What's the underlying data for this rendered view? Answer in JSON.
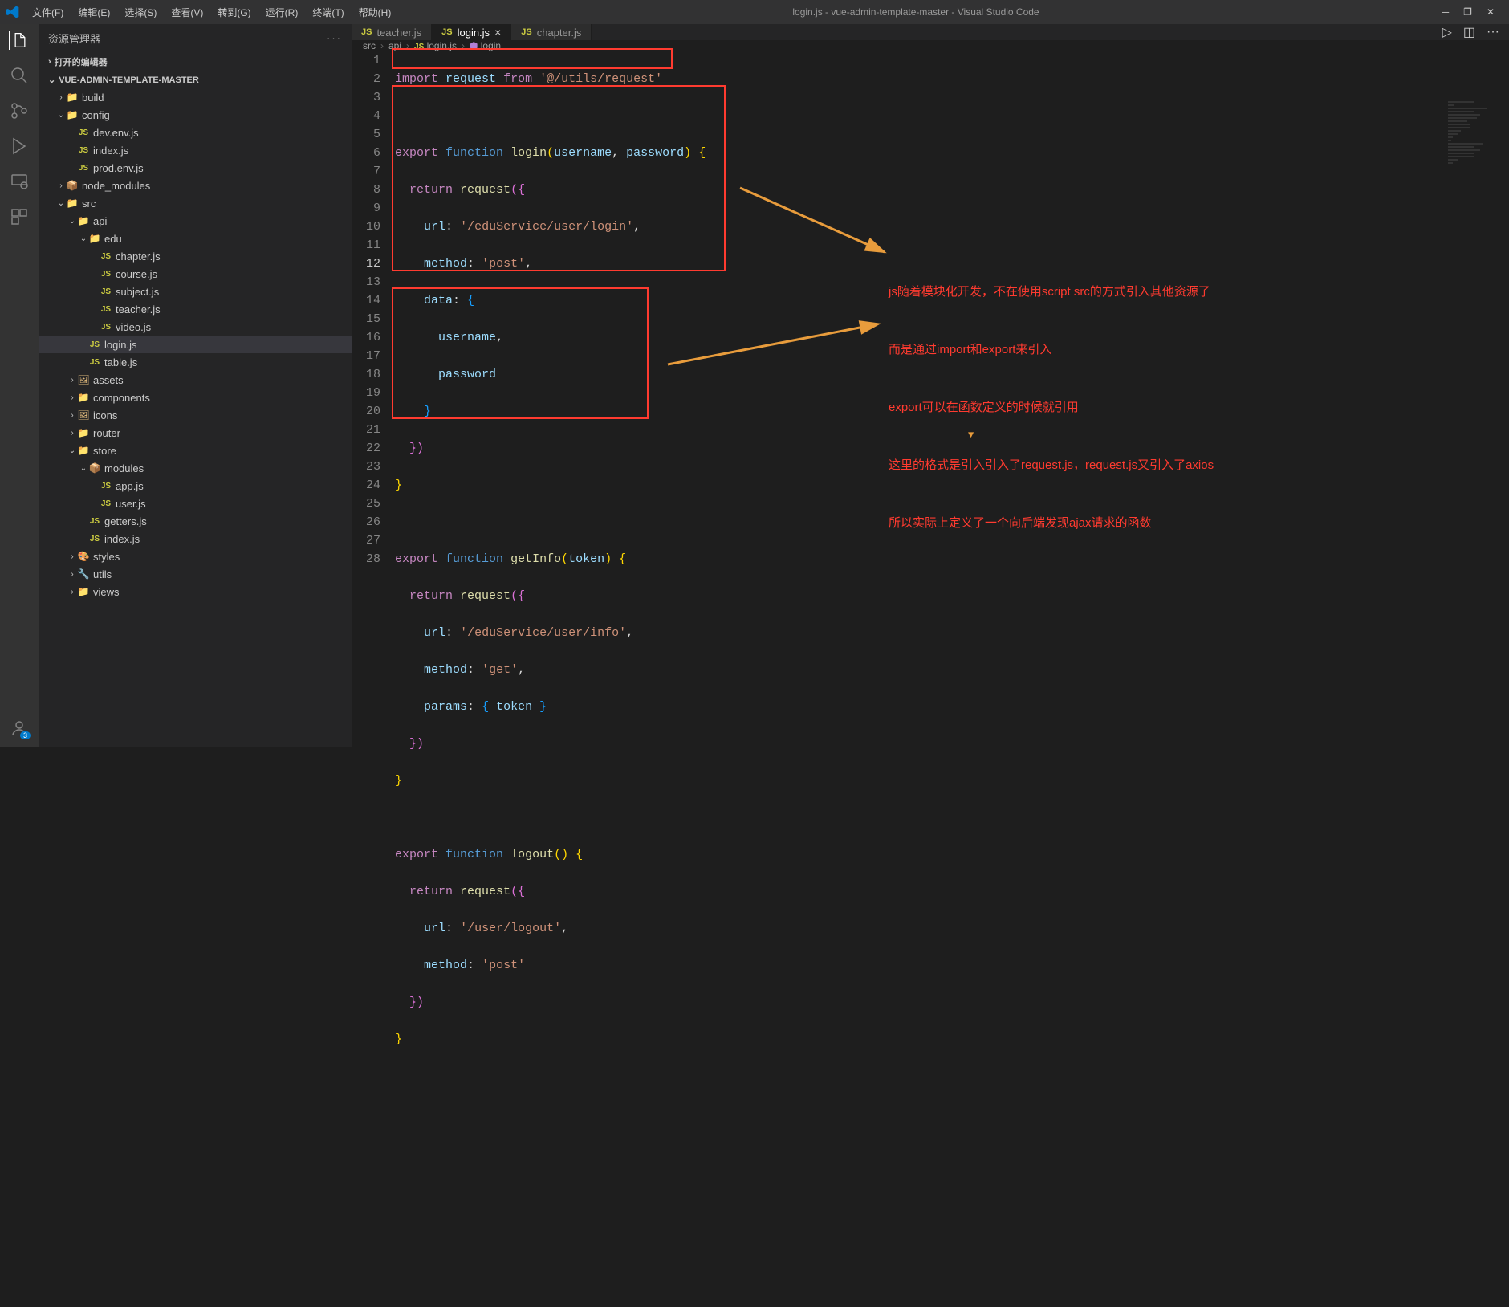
{
  "titlebar": {
    "menus": [
      "文件(F)",
      "编辑(E)",
      "选择(S)",
      "查看(V)",
      "转到(G)",
      "运行(R)",
      "终端(T)",
      "帮助(H)"
    ],
    "title": "login.js - vue-admin-template-master - Visual Studio Code"
  },
  "sidebar": {
    "title": "资源管理器",
    "open_editors": "打开的编辑器",
    "project": "VUE-ADMIN-TEMPLATE-MASTER",
    "tree": [
      {
        "depth": 1,
        "chev": ">",
        "type": "folder",
        "icon": "📁",
        "iconClass": "folder-co",
        "label": "build"
      },
      {
        "depth": 1,
        "chev": "v",
        "type": "folder",
        "icon": "📁",
        "iconClass": "folder-gr",
        "label": "config"
      },
      {
        "depth": 2,
        "chev": "",
        "type": "js",
        "label": "dev.env.js"
      },
      {
        "depth": 2,
        "chev": "",
        "type": "js",
        "label": "index.js"
      },
      {
        "depth": 2,
        "chev": "",
        "type": "js",
        "label": "prod.env.js"
      },
      {
        "depth": 1,
        "chev": ">",
        "type": "folder",
        "icon": "📦",
        "iconClass": "folder-gr",
        "label": "node_modules"
      },
      {
        "depth": 1,
        "chev": "v",
        "type": "folder",
        "icon": "📁",
        "iconClass": "folder-gr",
        "label": "src"
      },
      {
        "depth": 2,
        "chev": "v",
        "type": "folder",
        "icon": "📁",
        "iconClass": "folder-gr",
        "label": "api"
      },
      {
        "depth": 3,
        "chev": "v",
        "type": "folder",
        "icon": "📁",
        "iconClass": "folder-co",
        "label": "edu"
      },
      {
        "depth": 4,
        "chev": "",
        "type": "js",
        "label": "chapter.js"
      },
      {
        "depth": 4,
        "chev": "",
        "type": "js",
        "label": "course.js"
      },
      {
        "depth": 4,
        "chev": "",
        "type": "js",
        "label": "subject.js"
      },
      {
        "depth": 4,
        "chev": "",
        "type": "js",
        "label": "teacher.js"
      },
      {
        "depth": 4,
        "chev": "",
        "type": "js",
        "label": "video.js"
      },
      {
        "depth": 3,
        "chev": "",
        "type": "js",
        "label": "login.js",
        "selected": true
      },
      {
        "depth": 3,
        "chev": "",
        "type": "js",
        "label": "table.js"
      },
      {
        "depth": 2,
        "chev": ">",
        "type": "folder",
        "icon": "🖼",
        "iconClass": "folder-co",
        "label": "assets"
      },
      {
        "depth": 2,
        "chev": ">",
        "type": "folder",
        "icon": "📁",
        "iconClass": "folder-co",
        "label": "components"
      },
      {
        "depth": 2,
        "chev": ">",
        "type": "folder",
        "icon": "🖼",
        "iconClass": "folder-co",
        "label": "icons"
      },
      {
        "depth": 2,
        "chev": ">",
        "type": "folder",
        "icon": "📁",
        "iconClass": "folder-co",
        "label": "router"
      },
      {
        "depth": 2,
        "chev": "v",
        "type": "folder",
        "icon": "📁",
        "iconClass": "folder-co",
        "label": "store"
      },
      {
        "depth": 3,
        "chev": "v",
        "type": "folder",
        "icon": "📦",
        "iconClass": "folder-gr",
        "label": "modules"
      },
      {
        "depth": 4,
        "chev": "",
        "type": "js",
        "label": "app.js"
      },
      {
        "depth": 4,
        "chev": "",
        "type": "js",
        "label": "user.js"
      },
      {
        "depth": 3,
        "chev": "",
        "type": "js",
        "label": "getters.js"
      },
      {
        "depth": 3,
        "chev": "",
        "type": "js",
        "label": "index.js"
      },
      {
        "depth": 2,
        "chev": ">",
        "type": "folder",
        "icon": "🎨",
        "iconClass": "folder-co",
        "label": "styles"
      },
      {
        "depth": 2,
        "chev": ">",
        "type": "folder",
        "icon": "🔧",
        "iconClass": "folder-co",
        "label": "utils"
      },
      {
        "depth": 2,
        "chev": ">",
        "type": "folder",
        "icon": "📁",
        "iconClass": "folder-co",
        "label": "views"
      }
    ]
  },
  "tabs": [
    {
      "icon": "JS",
      "label": "teacher.js",
      "active": false
    },
    {
      "icon": "JS",
      "label": "login.js",
      "active": true,
      "close": true
    },
    {
      "icon": "JS",
      "label": "chapter.js",
      "active": false
    }
  ],
  "breadcrumb": [
    "src",
    "api",
    "login.js",
    "login"
  ],
  "code_lines": 28,
  "annotations": {
    "line1": "js随着模块化开发，不在使用script src的方式引入其他资源了",
    "line2": "而是通过import和export来引入",
    "line3": "export可以在函数定义的时候就引用",
    "line4": "这里的格式是引入引入了request.js，request.js又引入了axios",
    "line5": "所以实际上定义了一个向后端发现ajax请求的函数"
  },
  "code": {
    "l1": {
      "import": "import",
      "request": "request",
      "from": "from",
      "str": "'@/utils/request'"
    },
    "l3": {
      "export": "export",
      "function": "function",
      "name": "login",
      "p1": "username",
      "p2": "password"
    },
    "l4": {
      "return": "return",
      "request": "request"
    },
    "l5": {
      "url": "url",
      "val": "'/eduService/user/login'"
    },
    "l6": {
      "method": "method",
      "val": "'post'"
    },
    "l7": {
      "data": "data"
    },
    "l8": {
      "username": "username"
    },
    "l9": {
      "password": "password"
    },
    "l14": {
      "export": "export",
      "function": "function",
      "name": "getInfo",
      "p": "token"
    },
    "l15": {
      "return": "return",
      "request": "request"
    },
    "l16": {
      "url": "url",
      "val": "'/eduService/user/info'"
    },
    "l17": {
      "method": "method",
      "val": "'get'"
    },
    "l18": {
      "params": "params",
      "token": "token"
    },
    "l22": {
      "export": "export",
      "function": "function",
      "name": "logout"
    },
    "l23": {
      "return": "return",
      "request": "request"
    },
    "l24": {
      "url": "url",
      "val": "'/user/logout'"
    },
    "l25": {
      "method": "method",
      "val": "'post'"
    }
  }
}
